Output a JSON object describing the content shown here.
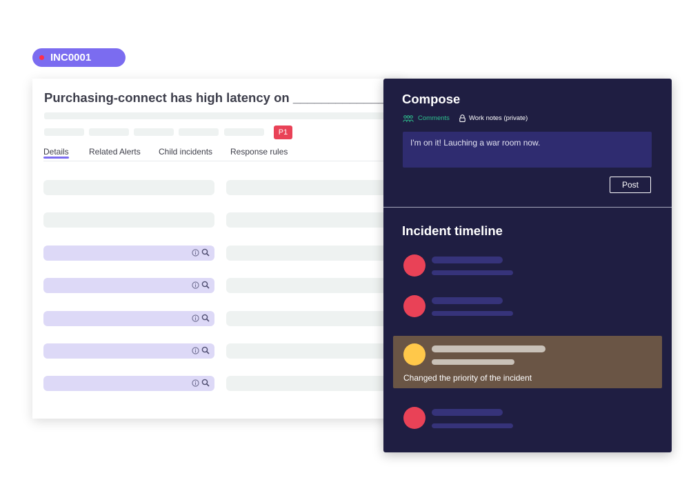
{
  "incident": {
    "id": "INC0001"
  },
  "details": {
    "title": "Purchasing-connect has high latency on _____________",
    "priority_badge": "P1",
    "tabs": [
      "Details",
      "Related Alerts",
      "Child incidents",
      "Response rules"
    ]
  },
  "compose": {
    "title": "Compose",
    "tab_comments": "Comments",
    "tab_work_notes": "Work notes (private)",
    "message": "I'm on it! Lauching a war room now.",
    "post_label": "Post"
  },
  "timeline": {
    "title": "Incident timeline",
    "highlight_text": "Changed the priority of the incident"
  },
  "colors": {
    "accent": "#7b6cf0",
    "panel": "#1f1e42",
    "danger": "#e94257",
    "warning": "#ffc84a",
    "success": "#2ec08e"
  },
  "icons": {
    "field": [
      "info-icon",
      "search-icon"
    ],
    "comments": "users-icon",
    "work_notes": "lock-icon"
  }
}
